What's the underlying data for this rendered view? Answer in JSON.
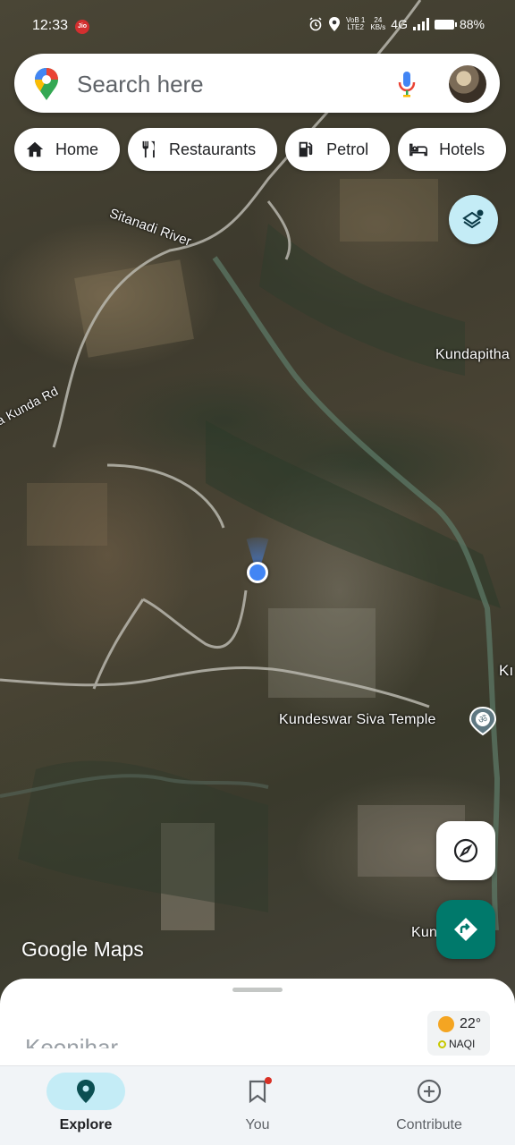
{
  "status_bar": {
    "time": "12:33",
    "carrier_badge": "Jio",
    "network_top": "VoB 1",
    "network_bottom": "LTE2",
    "speed_value": "24",
    "speed_unit": "KB/s",
    "network_type": "4G",
    "battery": "88%"
  },
  "search": {
    "placeholder": "Search here"
  },
  "chips": [
    {
      "label": "Home",
      "icon": "home-icon"
    },
    {
      "label": "Restaurants",
      "icon": "restaurant-icon"
    },
    {
      "label": "Petrol",
      "icon": "petrol-icon"
    },
    {
      "label": "Hotels",
      "icon": "hotel-icon"
    }
  ],
  "map": {
    "labels": {
      "river": "Sitanadi River",
      "road": "na Kunda Rd",
      "village": "Kundapitha",
      "edge": "Kı",
      "temple": "Kundeswar Siva Temple",
      "bottom_place": "Kun  n Po"
    },
    "attribution": "Google",
    "attribution_suffix": "Maps"
  },
  "sheet": {
    "title": "Keonjhar",
    "weather_temp": "22°",
    "weather_aqi": "NAQI"
  },
  "nav": {
    "items": [
      {
        "label": "Explore",
        "icon": "explore-pin-icon",
        "active": true
      },
      {
        "label": "You",
        "icon": "bookmark-icon",
        "active": false
      },
      {
        "label": "Contribute",
        "icon": "plus-circle-icon",
        "active": false
      }
    ]
  },
  "colors": {
    "accent": "#00796b",
    "active_pill": "#c4ecf6",
    "location_blue": "#4285f4"
  }
}
